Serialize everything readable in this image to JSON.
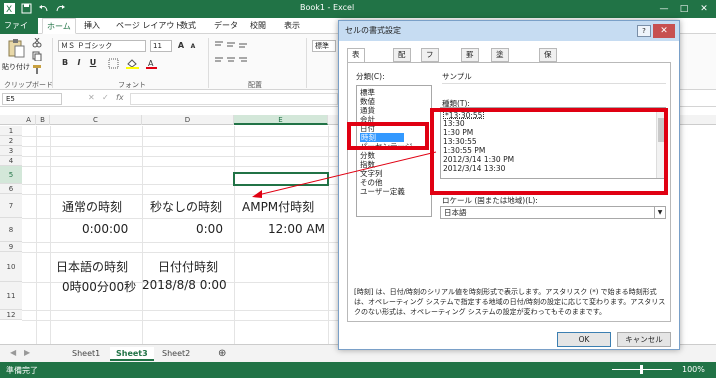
{
  "window": {
    "title": "Book1 - Excel",
    "minimize": "—",
    "maximize": "□",
    "close": "✕"
  },
  "ribbon_tabs": [
    "ファイル",
    "ホーム",
    "挿入",
    "ページ レイアウト",
    "数式",
    "データ",
    "校閲",
    "表示"
  ],
  "ribbon": {
    "paste_label": "貼り付け",
    "clipboard_label": "クリップボード",
    "font_name": "ＭＳ Ｐゴシック",
    "font_size": "11",
    "font_group_label": "フォント",
    "align_group_label": "配置",
    "number_format": "標準",
    "bold": "B",
    "italic": "I",
    "underline": "U",
    "grow": "A",
    "shrink": "A"
  },
  "formula_bar": {
    "name_box": "E5",
    "fx": "fx"
  },
  "sheet": {
    "columns": [
      "A",
      "B",
      "C",
      "D",
      "E"
    ],
    "selected_column": "E",
    "rows": [
      "1",
      "2",
      "3",
      "4",
      "5",
      "6",
      "7",
      "8",
      "9",
      "10",
      "11",
      "12"
    ],
    "selected_row": "5",
    "cells": {
      "c7": "通常の時刻",
      "d7": "秒なしの時刻",
      "e7": "AMPM付時刻",
      "c8": "0:00:00",
      "d8": "0:00",
      "e8": "12:00 AM",
      "c10": "日本語の時刻",
      "d10": "日付付時刻",
      "c11": "0時00分00秒",
      "d11": "2018/8/8 0:00"
    }
  },
  "sheet_tabs": {
    "items": [
      "Sheet1",
      "Sheet3",
      "Sheet2"
    ],
    "active": "Sheet3",
    "add": "⊕"
  },
  "status": {
    "text": "準備完了",
    "zoom": "100%"
  },
  "dialog": {
    "title": "セルの書式設定",
    "help": "?",
    "close": "✕",
    "tabs": [
      "表示形式",
      "配置",
      "フォント",
      "罫線",
      "塗りつぶし",
      "保護"
    ],
    "category_label": "分類(C):",
    "categories": [
      "標準",
      "数値",
      "通貨",
      "会計",
      "日付",
      "時刻",
      "パーセンテージ",
      "分数",
      "指数",
      "文字列",
      "その他",
      "ユーザー定義"
    ],
    "selected_category": "時刻",
    "sample_label": "サンプル",
    "type_label": "種類(T):",
    "types": [
      "*13:30:55",
      "13:30",
      "1:30 PM",
      "13:30:55",
      "1:30:55 PM",
      "2012/3/14 1:30 PM",
      "2012/3/14 13:30"
    ],
    "locale_label": "ロケール (国または地域)(L):",
    "locale_value": "日本語",
    "description": "[時刻] は、日付/時刻のシリアル値を時刻形式で表示します。アスタリスク (*) で始まる時刻形式は、オペレーティング システムで指定する地域の日付/時刻の設定に応じて変わります。アスタリスクのない形式は、オペレーティング システムの設定が変わってもそのままです。",
    "ok": "OK",
    "cancel": "キャンセル"
  },
  "colors": {
    "excel_green": "#217346",
    "highlight_red": "#e00012",
    "selection_blue": "#3399ff"
  }
}
